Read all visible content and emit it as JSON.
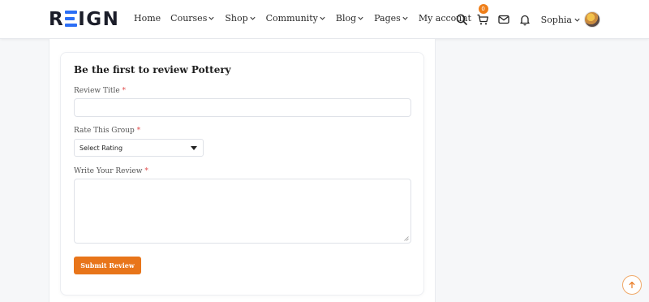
{
  "brand": {
    "logo_text_1": "R",
    "logo_text_2": "IGN",
    "accent": "#2b6ef5"
  },
  "nav": {
    "items": [
      {
        "label": "Home",
        "dropdown": false
      },
      {
        "label": "Courses",
        "dropdown": true
      },
      {
        "label": "Shop",
        "dropdown": true
      },
      {
        "label": "Community",
        "dropdown": true
      },
      {
        "label": "Blog",
        "dropdown": true
      },
      {
        "label": "Pages",
        "dropdown": true
      },
      {
        "label": "My account",
        "dropdown": false
      }
    ]
  },
  "header_actions": {
    "icons": [
      "search-icon",
      "cart-icon",
      "mail-icon",
      "bell-icon"
    ],
    "cart_count": "0",
    "user_name": "Sophia"
  },
  "review_form": {
    "title": "Be the first to review Pottery",
    "review_title_label": "Review Title",
    "rating_label": "Rate This Group",
    "rating_selected": "Select Rating",
    "review_label": "Write Your Review",
    "required_mark": "*",
    "submit_label": "Submit Review"
  },
  "colors": {
    "primary_button": "#e8751a",
    "badge": "#ef7f1a",
    "required": "#e04b4b"
  }
}
